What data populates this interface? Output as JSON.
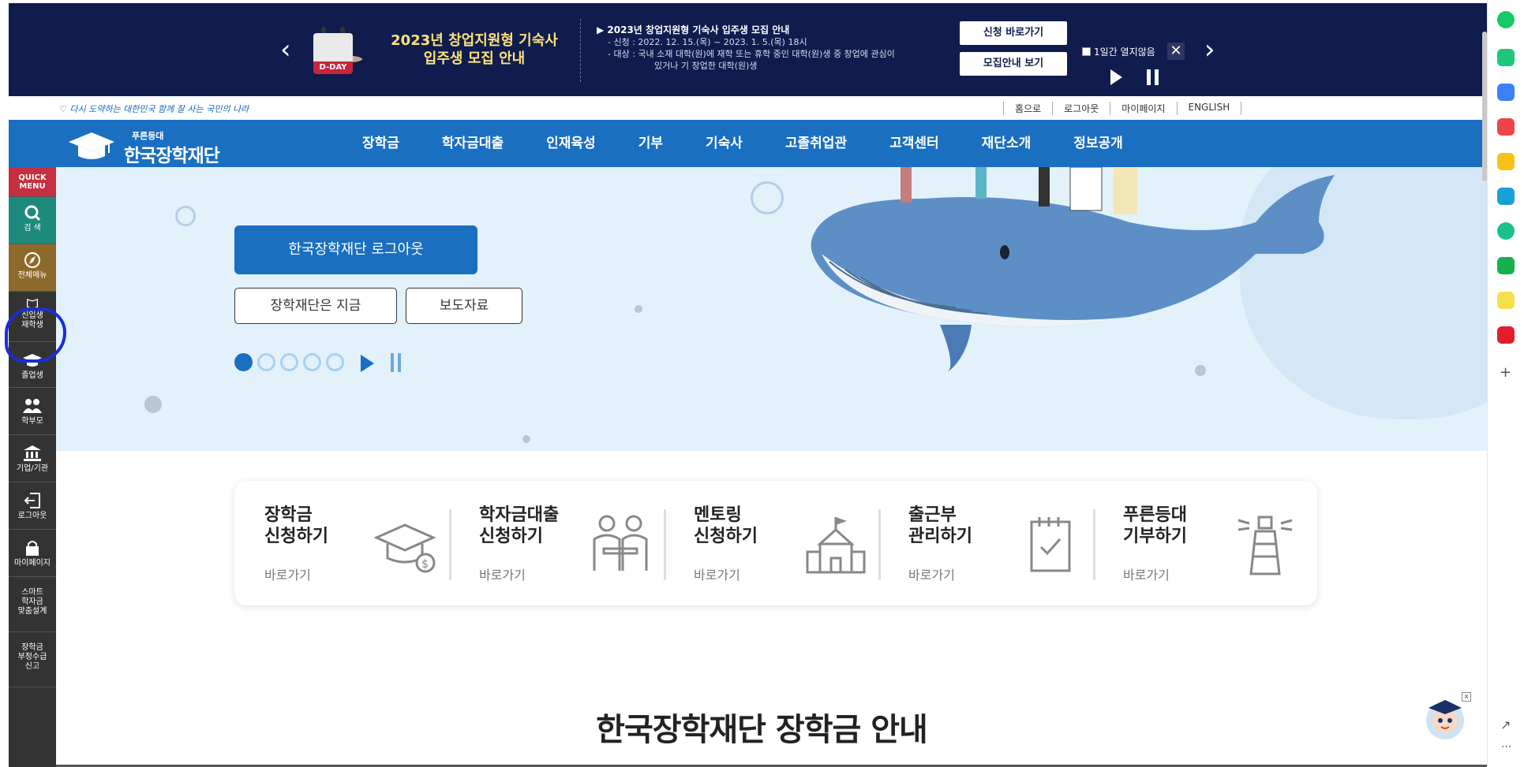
{
  "banner": {
    "calendar_label": "D-DAY",
    "title_line1": "2023년 창업지원형 기숙사",
    "title_line2": "입주생 모집 안내",
    "info_heading": "▶ 2023년 창업지원형 기숙사 입주생 모집 안내",
    "info_line1": "- 신청 : 2022. 12. 15.(목) ~ 2023. 1. 5.(목) 18시",
    "info_line2": "- 대상 : 국내 소재 대학(원)에 재학 또는 휴학 중인 대학(원)생 중 창업에 관심이",
    "info_line3": "있거나 기 창업한 대학(원)생",
    "apply_button": "신청 바로가기",
    "guide_button": "모집안내 보기",
    "hide_today": "1일간 열지않음",
    "close_symbol": "✕",
    "prev_symbol": "‹",
    "next_symbol": "›"
  },
  "util": {
    "slogan": "♡ 다시 도약하는 대한민국 함께 잘 사는 국민의 나라",
    "links": [
      "홈으로",
      "로그아웃",
      "마이페이지",
      "ENGLISH"
    ]
  },
  "logo": {
    "small": "푸른등대",
    "name": "한국장학재단"
  },
  "nav": [
    "장학금",
    "학자금대출",
    "인재육성",
    "기부",
    "기숙사",
    "고졸취업관",
    "고객센터",
    "재단소개",
    "정보공개"
  ],
  "hero": {
    "primary_button": "한국장학재단 로그아웃",
    "button_now": "장학재단은 지금",
    "button_press": "보도자료"
  },
  "quick_cards": [
    {
      "line1": "장학금",
      "line2": "신청하기",
      "go": "바로가기",
      "icon": "graduation-cap-dollar-icon"
    },
    {
      "line1": "학자금대출",
      "line2": "신청하기",
      "go": "바로가기",
      "icon": "people-desk-icon"
    },
    {
      "line1": "멘토링",
      "line2": "신청하기",
      "go": "바로가기",
      "icon": "school-building-icon"
    },
    {
      "line1": "출근부",
      "line2": "관리하기",
      "go": "바로가기",
      "icon": "notepad-check-icon"
    },
    {
      "line1": "푸른등대",
      "line2": "기부하기",
      "go": "바로가기",
      "icon": "lighthouse-icon"
    }
  ],
  "section_title": "한국장학재단 장학금 안내",
  "quick_menu": {
    "head": "QUICK MENU",
    "items": [
      {
        "label": "검 색",
        "icon": "search-icon"
      },
      {
        "label": "전체메뉴",
        "icon": "compass-icon"
      },
      {
        "label1": "신입생",
        "label2": "재학생",
        "icon": "book-icon"
      },
      {
        "label": "졸업생",
        "icon": "graduation-cap-icon"
      },
      {
        "label": "학부모",
        "icon": "parents-icon"
      },
      {
        "label": "기업/기관",
        "icon": "institution-icon"
      },
      {
        "label": "로그아웃",
        "icon": "logout-icon"
      },
      {
        "label": "마이페이지",
        "icon": "lock-icon"
      },
      {
        "label1": "스마트",
        "label2": "학자금",
        "label3": "맞춤설계"
      },
      {
        "label1": "장학금",
        "label2": "부정수급",
        "label3": "신고"
      }
    ]
  },
  "colors": {
    "banner_bg": "#0f1c4d",
    "banner_title": "#ffe27a",
    "gnb_bg": "#1a6fc0",
    "hero_bg": "#e3f1fb",
    "quick_head": "#c62f3f",
    "quick_search": "#1d8a7d",
    "quick_all": "#8d6a2b",
    "annotation": "#1b2dd6"
  }
}
